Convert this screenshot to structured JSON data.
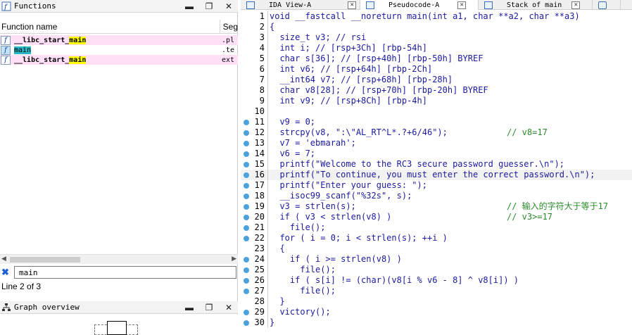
{
  "functions_panel": {
    "title": "Functions",
    "columns": [
      "Function name",
      "Segment"
    ],
    "rows": [
      {
        "name_pre": "__libc_start_",
        "name_hl": "main",
        "segment": ".pl",
        "style": "pink"
      },
      {
        "name_pre": "",
        "name_hl": "main",
        "segment": ".te",
        "style": "plain"
      },
      {
        "name_pre": "__libc_start_",
        "name_hl": "main",
        "segment": "ext",
        "style": "pink"
      }
    ],
    "search_value": "main",
    "status": "Line 2 of 3"
  },
  "graph_overview": {
    "title": "Graph overview"
  },
  "tabs": [
    {
      "label": "IDA View-A",
      "active": false
    },
    {
      "label": "Pseudocode-A",
      "active": true
    },
    {
      "label": "Stack of main",
      "active": false
    }
  ],
  "code_lines": [
    {
      "n": "1",
      "text": "void __fastcall __noreturn main(int a1, char **a2, char **a3)",
      "comment": "",
      "dot": false,
      "hl": false
    },
    {
      "n": "2",
      "text": "{",
      "comment": "",
      "dot": false,
      "hl": false
    },
    {
      "n": "3",
      "text": "  size_t v3; // rsi",
      "comment": "",
      "dot": false,
      "hl": false
    },
    {
      "n": "4",
      "text": "  int i; // [rsp+3Ch] [rbp-54h]",
      "comment": "",
      "dot": false,
      "hl": false
    },
    {
      "n": "5",
      "text": "  char s[36]; // [rsp+40h] [rbp-50h] BYREF",
      "comment": "",
      "dot": false,
      "hl": false
    },
    {
      "n": "6",
      "text": "  int v6; // [rsp+64h] [rbp-2Ch]",
      "comment": "",
      "dot": false,
      "hl": false
    },
    {
      "n": "7",
      "text": "  __int64 v7; // [rsp+68h] [rbp-28h]",
      "comment": "",
      "dot": false,
      "hl": false
    },
    {
      "n": "8",
      "text": "  char v8[28]; // [rsp+70h] [rbp-20h] BYREF",
      "comment": "",
      "dot": false,
      "hl": false
    },
    {
      "n": "9",
      "text": "  int v9; // [rsp+8Ch] [rbp-4h]",
      "comment": "",
      "dot": false,
      "hl": false
    },
    {
      "n": "10",
      "text": "",
      "comment": "",
      "dot": false,
      "hl": false
    },
    {
      "n": "11",
      "text": "  v9 = 0;",
      "comment": "",
      "dot": true,
      "hl": false
    },
    {
      "n": "12",
      "text": "  strcpy(v8, \":\\\"AL_RT^L*.?+6/46\");",
      "comment": "// v8=17",
      "dot": true,
      "hl": false
    },
    {
      "n": "13",
      "text": "  v7 = 'ebmarah';",
      "comment": "",
      "dot": true,
      "hl": false
    },
    {
      "n": "14",
      "text": "  v6 = 7;",
      "comment": "",
      "dot": true,
      "hl": false
    },
    {
      "n": "15",
      "text": "  printf(\"Welcome to the RC3 secure password guesser.\\n\");",
      "comment": "",
      "dot": true,
      "hl": false
    },
    {
      "n": "16",
      "text": "  printf(\"To continue, you must enter the correct password.\\n\");",
      "comment": "",
      "dot": true,
      "hl": true
    },
    {
      "n": "17",
      "text": "  printf(\"Enter your guess: \");",
      "comment": "",
      "dot": true,
      "hl": false
    },
    {
      "n": "18",
      "text": "  __isoc99_scanf(\"%32s\", s);",
      "comment": "",
      "dot": true,
      "hl": false
    },
    {
      "n": "19",
      "text": "  v3 = strlen(s);",
      "comment": "// 输入的字符大于等于17",
      "dot": true,
      "hl": false
    },
    {
      "n": "20",
      "text": "  if ( v3 < strlen(v8) )",
      "comment": "// v3>=17",
      "dot": true,
      "hl": false
    },
    {
      "n": "21",
      "text": "    file();",
      "comment": "",
      "dot": true,
      "hl": false
    },
    {
      "n": "22",
      "text": "  for ( i = 0; i < strlen(s); ++i )",
      "comment": "",
      "dot": true,
      "hl": false
    },
    {
      "n": "23",
      "text": "  {",
      "comment": "",
      "dot": false,
      "hl": false
    },
    {
      "n": "24",
      "text": "    if ( i >= strlen(v8) )",
      "comment": "",
      "dot": true,
      "hl": false
    },
    {
      "n": "25",
      "text": "      file();",
      "comment": "",
      "dot": true,
      "hl": false
    },
    {
      "n": "26",
      "text": "    if ( s[i] != (char)(v8[i % v6 - 8] ^ v8[i]) )",
      "comment": "",
      "dot": true,
      "hl": false
    },
    {
      "n": "27",
      "text": "      file();",
      "comment": "",
      "dot": true,
      "hl": false
    },
    {
      "n": "28",
      "text": "  }",
      "comment": "",
      "dot": false,
      "hl": false
    },
    {
      "n": "29",
      "text": "  victory();",
      "comment": "",
      "dot": true,
      "hl": false
    },
    {
      "n": "30",
      "text": "}",
      "comment": "",
      "dot": true,
      "hl": false
    }
  ]
}
